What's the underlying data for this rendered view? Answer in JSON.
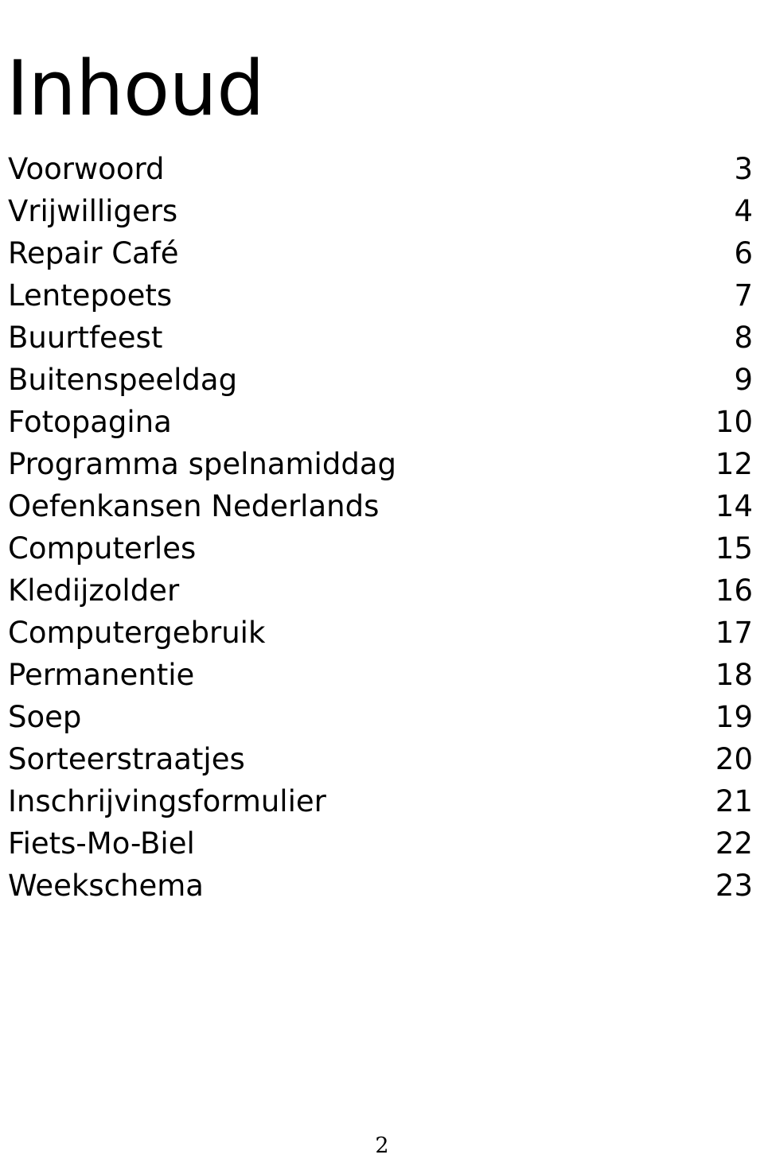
{
  "document": {
    "title": "Inhoud",
    "footer_page_number": "2"
  },
  "toc": {
    "entries": [
      {
        "label": "Voorwoord",
        "page": "3"
      },
      {
        "label": "Vrijwilligers",
        "page": "4"
      },
      {
        "label": "Repair Café",
        "page": "6"
      },
      {
        "label": "Lentepoets",
        "page": "7"
      },
      {
        "label": "Buurtfeest",
        "page": "8"
      },
      {
        "label": "Buitenspeeldag",
        "page": "9"
      },
      {
        "label": "Fotopagina",
        "page": "10"
      },
      {
        "label": "Programma spelnamiddag",
        "page": "12"
      },
      {
        "label": "Oefenkansen Nederlands",
        "page": "14"
      },
      {
        "label": "Computerles",
        "page": "15"
      },
      {
        "label": "Kledijzolder",
        "page": "16"
      },
      {
        "label": "Computergebruik",
        "page": "17"
      },
      {
        "label": "Permanentie",
        "page": "18"
      },
      {
        "label": "Soep",
        "page": "19"
      },
      {
        "label": "Sorteerstraatjes",
        "page": "20"
      },
      {
        "label": "Inschrijvingsformulier",
        "page": "21"
      },
      {
        "label": "Fiets-Mo-Biel",
        "page": "22"
      },
      {
        "label": "Weekschema",
        "page": "23"
      }
    ]
  },
  "colors": {
    "background": "#ffffff",
    "text": "#000000"
  }
}
